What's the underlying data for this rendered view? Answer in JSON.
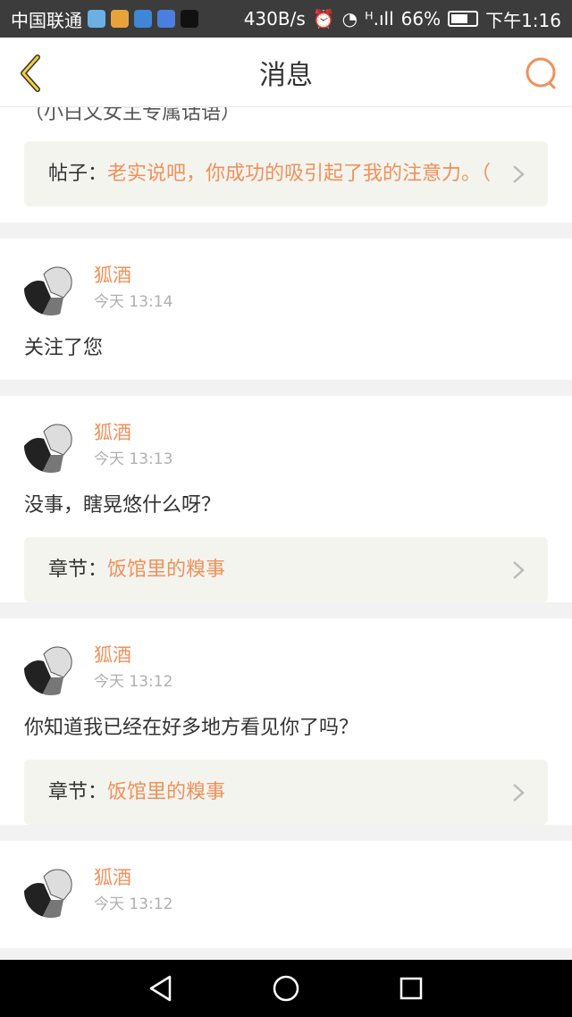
{
  "status_bar": {
    "carrier": "中国联通",
    "net_speed": "430B/s",
    "signal": "ᴴ.ıll",
    "battery": "66%",
    "time": "下午1:16",
    "app_icons": [
      "video-app-icon",
      "weibo-icon",
      "browser-icon",
      "baidu-icon",
      "tiktok-icon"
    ],
    "colors": {
      "bg": "#3c3c3c"
    }
  },
  "header": {
    "title": "消息",
    "back_icon": "chevron-left-icon",
    "search_icon": "search-icon"
  },
  "top_partial": {
    "text": "（小白文女主专属话语）",
    "ref_label": "帖子：",
    "ref_text": "老实说吧，你成功的吸引起了我的注意力。（"
  },
  "messages": [
    {
      "username": "狐酒",
      "time": "今天 13:14",
      "text": "关注了您"
    },
    {
      "username": "狐酒",
      "time": "今天 13:13",
      "text": "没事，瞎晃悠什么呀？",
      "ref_label": "章节：",
      "ref_text": "饭馆里的糗事"
    },
    {
      "username": "狐酒",
      "time": "今天 13:12",
      "text": "你知道我已经在好多地方看见你了吗？",
      "ref_label": "章节：",
      "ref_text": "饭馆里的糗事"
    },
    {
      "username": "狐酒",
      "time": "今天 13:12"
    }
  ],
  "accent_color": "#f0915a",
  "nav_icons": [
    "back-triangle-icon",
    "home-circle-icon",
    "recents-square-icon"
  ]
}
